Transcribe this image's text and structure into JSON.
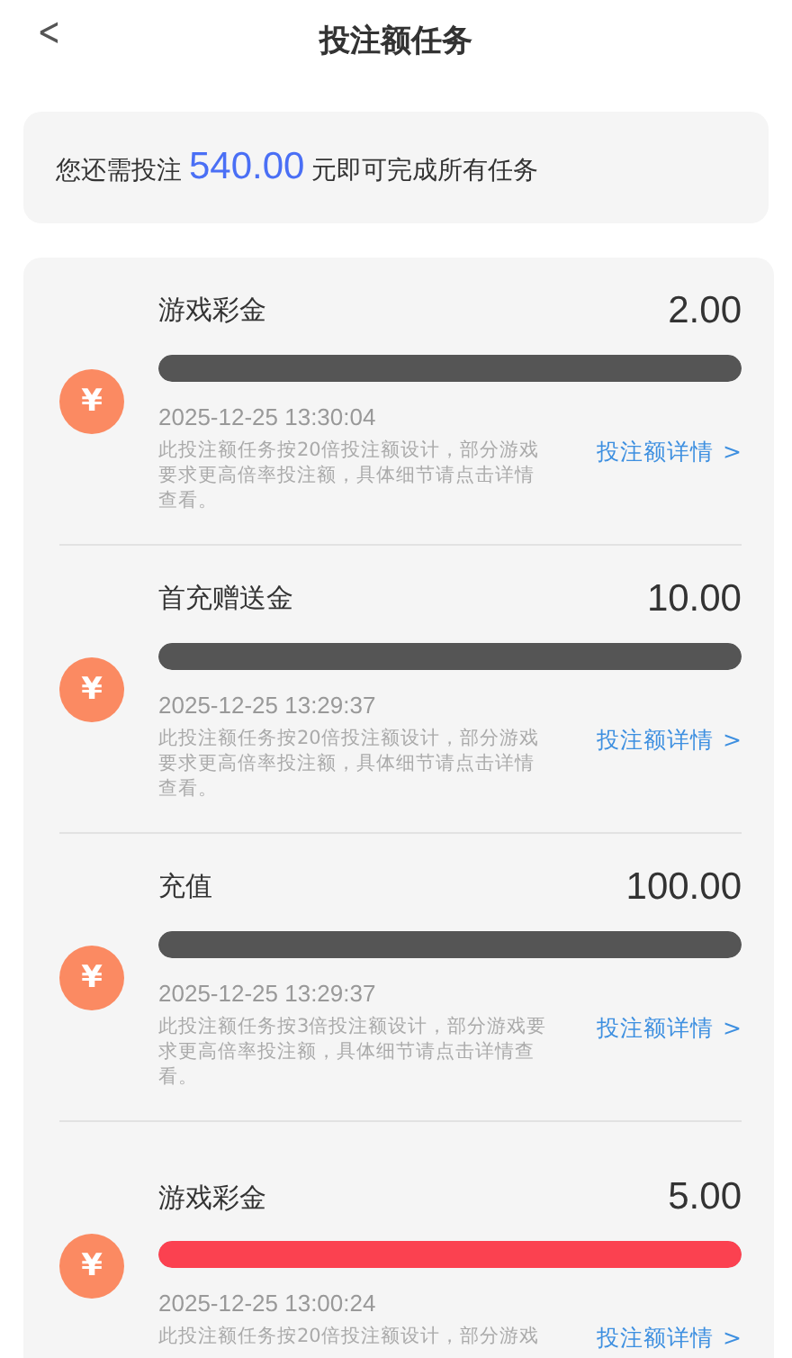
{
  "header": {
    "back": "<",
    "title": "投注额任务"
  },
  "summary": {
    "prefix": "您还需投注",
    "amount": "540.00",
    "suffix": "元即可完成所有任务"
  },
  "tasks": [
    {
      "icon": "¥",
      "name": "游戏彩金",
      "amount": "2.00",
      "level": 1,
      "color": "#555555",
      "time": "2025-12-25 13:30:04",
      "description": "此投注额任务按20倍投注额设计，部分游戏要求更高倍率投注额，具体细节请点击详情查看。",
      "link": "投注额详情",
      "chevron": ">"
    },
    {
      "icon": "¥",
      "name": "首充赠送金",
      "amount": "10.00",
      "level": 1,
      "color": "#555555",
      "time": "2025-12-25 13:29:37",
      "description": "此投注额任务按20倍投注额设计，部分游戏要求更高倍率投注额，具体细节请点击详情查看。",
      "link": "投注额详情",
      "chevron": ">"
    },
    {
      "icon": "¥",
      "name": "充值",
      "amount": "100.00",
      "level": 1,
      "color": "#555555",
      "time": "2025-12-25 13:29:37",
      "description": "此投注额任务按3倍投注额设计，部分游戏要求更高倍率投注额，具体细节请点击详情查看。",
      "link": "投注额详情",
      "chevron": ">"
    },
    {
      "icon": "¥",
      "name": "游戏彩金",
      "amount": "5.00",
      "level": 1,
      "color": "#fb4150",
      "time": "2025-12-25 13:00:24",
      "description": "此投注额任务按20倍投注额设计，部分游戏",
      "link": "投注额详情",
      "chevron": ">"
    }
  ]
}
